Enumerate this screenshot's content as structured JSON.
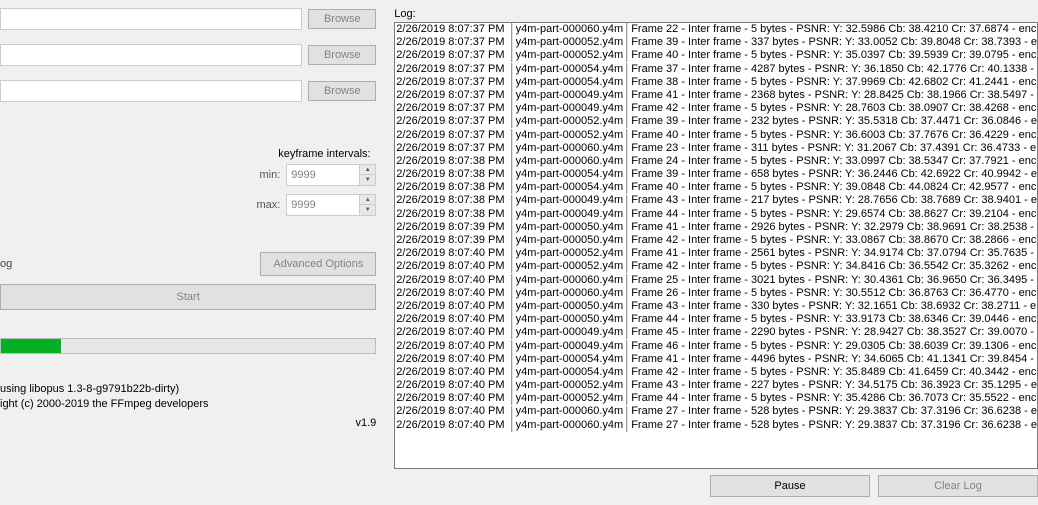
{
  "left": {
    "browse": "Browse",
    "keyframe_intervals_label": "keyframe intervals:",
    "min_label": "min:",
    "max_label": "max:",
    "min_value": "9999",
    "max_value": "9999",
    "log_toggle": "og",
    "advanced": "Advanced Options",
    "start": "Start",
    "progress_percent": 16,
    "credits_line1": "using libopus 1.3-8-g9791b22b-dirty)",
    "credits_line2": "ight (c) 2000-2019 the FFmpeg developers",
    "version": "v1.9"
  },
  "log_label": "Log:",
  "log_entries": [
    {
      "ts": "2/26/2019 8:07:37 PM",
      "file": "y4m-part-000060.y4m",
      "msg": "Frame 22 - Inter frame - 5 bytes - PSNR: Y: 32.5986  Cb: 38.4210  Cr: 37.6874 - enc"
    },
    {
      "ts": "2/26/2019 8:07:37 PM",
      "file": "y4m-part-000052.y4m",
      "msg": "Frame 39 - Inter frame - 337 bytes - PSNR: Y: 33.0052  Cb: 39.8048  Cr: 38.7393 - e"
    },
    {
      "ts": "2/26/2019 8:07:37 PM",
      "file": "y4m-part-000052.y4m",
      "msg": "Frame 40 - Inter frame - 5 bytes - PSNR: Y: 35.0397  Cb: 39.5939  Cr: 39.0795 - enc"
    },
    {
      "ts": "2/26/2019 8:07:37 PM",
      "file": "y4m-part-000054.y4m",
      "msg": "Frame 37 - Inter frame - 4287 bytes - PSNR: Y: 36.1850  Cb: 42.1776  Cr: 40.1338 -"
    },
    {
      "ts": "2/26/2019 8:07:37 PM",
      "file": "y4m-part-000054.y4m",
      "msg": "Frame 38 - Inter frame - 5 bytes - PSNR: Y: 37.9969  Cb: 42.6802  Cr: 41.2441 - enc"
    },
    {
      "ts": "2/26/2019 8:07:37 PM",
      "file": "y4m-part-000049.y4m",
      "msg": "Frame 41 - Inter frame - 2368 bytes - PSNR: Y: 28.8425  Cb: 38.1966  Cr: 38.5497 -"
    },
    {
      "ts": "2/26/2019 8:07:37 PM",
      "file": "y4m-part-000049.y4m",
      "msg": "Frame 42 - Inter frame - 5 bytes - PSNR: Y: 28.7603  Cb: 38.0907  Cr: 38.4268 - enc"
    },
    {
      "ts": "2/26/2019 8:07:37 PM",
      "file": "y4m-part-000052.y4m",
      "msg": "Frame 39 - Inter frame - 232 bytes - PSNR: Y: 35.5318  Cb: 37.4471  Cr: 36.0846 - e"
    },
    {
      "ts": "2/26/2019 8:07:37 PM",
      "file": "y4m-part-000052.y4m",
      "msg": "Frame 40 - Inter frame - 5 bytes - PSNR: Y: 36.6003  Cb: 37.7676  Cr: 36.4229 - enc"
    },
    {
      "ts": "2/26/2019 8:07:37 PM",
      "file": "y4m-part-000060.y4m",
      "msg": "Frame 23 - Inter frame - 311 bytes - PSNR: Y: 31.2067  Cb: 37.4391  Cr: 36.4733 - e"
    },
    {
      "ts": "2/26/2019 8:07:38 PM",
      "file": "y4m-part-000060.y4m",
      "msg": "Frame 24 - Inter frame - 5 bytes - PSNR: Y: 33.0997  Cb: 38.5347  Cr: 37.7921 - enc"
    },
    {
      "ts": "2/26/2019 8:07:38 PM",
      "file": "y4m-part-000054.y4m",
      "msg": "Frame 39 - Inter frame - 658 bytes - PSNR: Y: 36.2446  Cb: 42.6922  Cr: 40.9942 - e"
    },
    {
      "ts": "2/26/2019 8:07:38 PM",
      "file": "y4m-part-000054.y4m",
      "msg": "Frame 40 - Inter frame - 5 bytes - PSNR: Y: 39.0848  Cb: 44.0824  Cr: 42.9577 - enc"
    },
    {
      "ts": "2/26/2019 8:07:38 PM",
      "file": "y4m-part-000049.y4m",
      "msg": "Frame 43 - Inter frame - 217 bytes - PSNR: Y: 28.7656  Cb: 38.7689  Cr: 38.9401 - e"
    },
    {
      "ts": "2/26/2019 8:07:38 PM",
      "file": "y4m-part-000049.y4m",
      "msg": "Frame 44 - Inter frame - 5 bytes - PSNR: Y: 29.6574  Cb: 38.8627  Cr: 39.2104 - enc"
    },
    {
      "ts": "2/26/2019 8:07:39 PM",
      "file": "y4m-part-000050.y4m",
      "msg": "Frame 41 - Inter frame - 2926 bytes - PSNR: Y: 32.2979  Cb: 38.9691  Cr: 38.2538 -"
    },
    {
      "ts": "2/26/2019 8:07:39 PM",
      "file": "y4m-part-000050.y4m",
      "msg": "Frame 42 - Inter frame - 5 bytes - PSNR: Y: 33.0867  Cb: 38.8670  Cr: 38.2866 - enc"
    },
    {
      "ts": "2/26/2019 8:07:40 PM",
      "file": "y4m-part-000052.y4m",
      "msg": "Frame 41 - Inter frame - 2561 bytes - PSNR: Y: 34.9174  Cb: 37.0794  Cr: 35.7635 -"
    },
    {
      "ts": "2/26/2019 8:07:40 PM",
      "file": "y4m-part-000052.y4m",
      "msg": "Frame 42 - Inter frame - 5 bytes - PSNR: Y: 34.8416  Cb: 36.5542  Cr: 35.3262 - enc"
    },
    {
      "ts": "2/26/2019 8:07:40 PM",
      "file": "y4m-part-000060.y4m",
      "msg": "Frame 25 - Inter frame - 3021 bytes - PSNR: Y: 30.4361  Cb: 36.9650  Cr: 36.3495 -"
    },
    {
      "ts": "2/26/2019 8:07:40 PM",
      "file": "y4m-part-000060.y4m",
      "msg": "Frame 26 - Inter frame - 5 bytes - PSNR: Y: 30.5512  Cb: 36.8763  Cr: 36.4770 - enc"
    },
    {
      "ts": "2/26/2019 8:07:40 PM",
      "file": "y4m-part-000050.y4m",
      "msg": "Frame 43 - Inter frame - 330 bytes - PSNR: Y: 32.1651  Cb: 38.6932  Cr: 38.2711 - e"
    },
    {
      "ts": "2/26/2019 8:07:40 PM",
      "file": "y4m-part-000050.y4m",
      "msg": "Frame 44 - Inter frame - 5 bytes - PSNR: Y: 33.9173  Cb: 38.6346  Cr: 39.0446 - enc"
    },
    {
      "ts": "2/26/2019 8:07:40 PM",
      "file": "y4m-part-000049.y4m",
      "msg": "Frame 45 - Inter frame - 2290 bytes - PSNR: Y: 28.9427  Cb: 38.3527  Cr: 39.0070 -"
    },
    {
      "ts": "2/26/2019 8:07:40 PM",
      "file": "y4m-part-000049.y4m",
      "msg": "Frame 46 - Inter frame - 5 bytes - PSNR: Y: 29.0305  Cb: 38.6039  Cr: 39.1306 - enc"
    },
    {
      "ts": "2/26/2019 8:07:40 PM",
      "file": "y4m-part-000054.y4m",
      "msg": "Frame 41 - Inter frame - 4496 bytes - PSNR: Y: 34.6065  Cb: 41.1341  Cr: 39.8454 -"
    },
    {
      "ts": "2/26/2019 8:07:40 PM",
      "file": "y4m-part-000054.y4m",
      "msg": "Frame 42 - Inter frame - 5 bytes - PSNR: Y: 35.8489  Cb: 41.6459  Cr: 40.3442 - enc"
    },
    {
      "ts": "2/26/2019 8:07:40 PM",
      "file": "y4m-part-000052.y4m",
      "msg": "Frame 43 - Inter frame - 227 bytes - PSNR: Y: 34.5175  Cb: 36.3923  Cr: 35.1295 - e"
    },
    {
      "ts": "2/26/2019 8:07:40 PM",
      "file": "y4m-part-000052.y4m",
      "msg": "Frame 44 - Inter frame - 5 bytes - PSNR: Y: 35.4286  Cb: 36.7073  Cr: 35.5522 - enc"
    },
    {
      "ts": "2/26/2019 8:07:40 PM",
      "file": "y4m-part-000060.y4m",
      "msg": "Frame 27 - Inter frame - 528 bytes - PSNR: Y: 29.3837  Cb: 37.3196  Cr: 36.6238 - e"
    },
    {
      "ts": "2/26/2019 8:07:40 PM",
      "file": "y4m-part-000060.y4m",
      "msg": "Frame 27 - Inter frame - 528 bytes - PSNR: Y: 29.3837  Cb: 37.3196  Cr: 36.6238 - e"
    }
  ],
  "bottom_buttons": {
    "pause": "Pause",
    "clear_log": "Clear Log"
  }
}
